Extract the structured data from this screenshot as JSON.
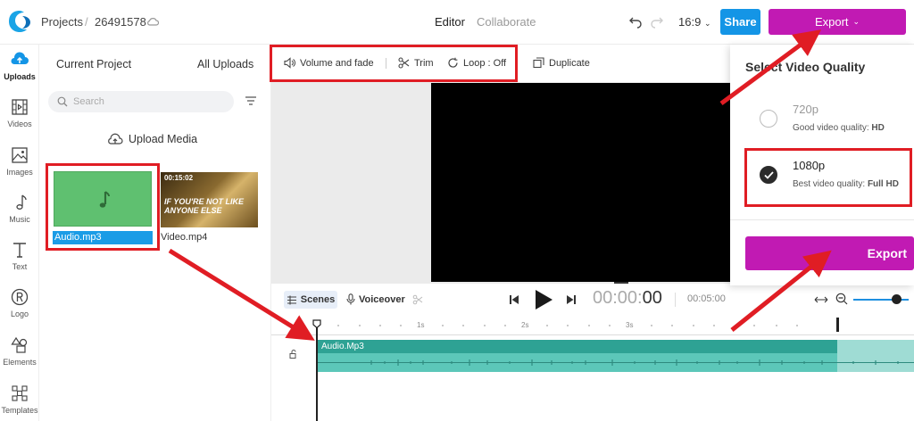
{
  "header": {
    "project_label": "Projects",
    "separator": "/",
    "project_id": "26491578",
    "mode_editor": "Editor",
    "mode_collaborate": "Collaborate",
    "aspect_ratio": "16:9",
    "share_label": "Share",
    "export_label": "Export"
  },
  "rail": {
    "items": [
      {
        "label": "Uploads",
        "icon": "upload-cloud-icon"
      },
      {
        "label": "Videos",
        "icon": "film-icon"
      },
      {
        "label": "Images",
        "icon": "image-icon"
      },
      {
        "label": "Music",
        "icon": "music-note-icon"
      },
      {
        "label": "Text",
        "icon": "text-icon"
      },
      {
        "label": "Logo",
        "icon": "registered-icon"
      },
      {
        "label": "Elements",
        "icon": "shapes-icon"
      },
      {
        "label": "Templates",
        "icon": "grid-icon"
      }
    ]
  },
  "panel": {
    "tab_current": "Current Project",
    "tab_all": "All Uploads",
    "search_placeholder": "Search",
    "upload_label": "Upload Media",
    "media": [
      {
        "name": "Audio.mp3",
        "type": "audio"
      },
      {
        "name": "Video.mp4",
        "type": "video",
        "timestamp": "00:15:02",
        "caption": "IF YOU'RE NOT LIKE ANYONE ELSE"
      }
    ]
  },
  "toolbar": {
    "volume_label": "Volume and fade",
    "trim_label": "Trim",
    "loop_label": "Loop : Off",
    "duplicate_label": "Duplicate"
  },
  "controls": {
    "scenes_label": "Scenes",
    "voiceover_label": "Voiceover",
    "timecode_dim": "00:00:",
    "timecode_bold": "00",
    "duration": "00:05:00"
  },
  "timeline": {
    "ticks": [
      "1s",
      "2s",
      "3s"
    ],
    "track_label": "Audio.Mp3"
  },
  "export_panel": {
    "title": "Select Video Quality",
    "options": [
      {
        "quality": "720p",
        "desc_prefix": "Good video quality: ",
        "desc_value": "HD",
        "selected": false
      },
      {
        "quality": "1080p",
        "desc_prefix": "Best video quality: ",
        "desc_value": "Full HD",
        "selected": true
      }
    ],
    "export_button": "Export"
  },
  "colors": {
    "accent_magenta": "#c11ab3",
    "share_blue": "#1495e6",
    "annotation_red": "#e01d24",
    "audio_green": "#5fc070",
    "track_teal": "#5cc7b9"
  }
}
